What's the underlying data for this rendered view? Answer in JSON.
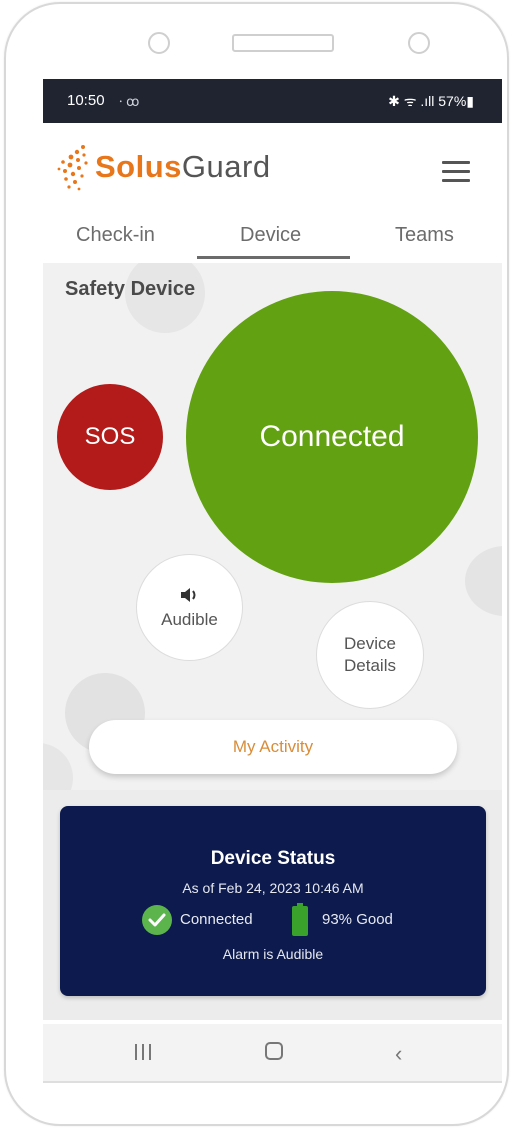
{
  "status_bar": {
    "time": "10:50",
    "left_icons": "⸱ ꝏ",
    "right_icons": "✱ ᯤ .ıll 57%▮"
  },
  "header": {
    "brand_part1": "Solus",
    "brand_part2": "Guard",
    "brand_color": "#e8761b"
  },
  "tabs": [
    {
      "label": "Check-in"
    },
    {
      "label": "Device"
    },
    {
      "label": "Teams"
    }
  ],
  "device": {
    "section_title": "Safety Device",
    "sos_label": "SOS",
    "connection_label": "Connected",
    "audible_icon": "speaker-icon",
    "audible_label": "Audible",
    "details_label_line1": "Device",
    "details_label_line2": "Details",
    "activity_label": "My Activity",
    "colors": {
      "sos": "#b31b1b",
      "connected": "#62a112",
      "activity_text": "#d98d3a"
    }
  },
  "status_card": {
    "title": "Device Status",
    "as_of": "As of Feb 24, 2023 10:46 AM",
    "connection": "Connected",
    "battery": "93% Good",
    "battery_level": 93,
    "alarm": "Alarm is Audible",
    "colors": {
      "background": "#0c1a4d",
      "check": "#5bb54c",
      "battery": "#3aa12a"
    }
  },
  "nav_bar": {
    "recent_icon": "recent-apps-icon",
    "home_icon": "home-icon",
    "back_icon": "back-icon"
  }
}
